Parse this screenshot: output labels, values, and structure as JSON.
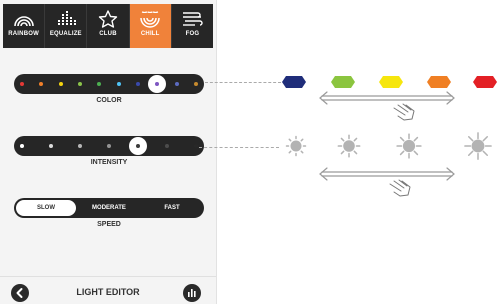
{
  "mode_bar": {
    "modes": [
      {
        "label": "RAINBOW",
        "icon": "rainbow-icon"
      },
      {
        "label": "EQUALIZE",
        "icon": "equalizer-icon"
      },
      {
        "label": "CLUB",
        "icon": "star-icon"
      },
      {
        "label": "CHILL",
        "icon": "waves-icon",
        "active": true
      },
      {
        "label": "FOG",
        "icon": "fog-icon"
      }
    ],
    "active_color": "#f0823a",
    "bar_color": "#262626"
  },
  "color_slider": {
    "caption": "COLOR",
    "dot_colors": [
      "#e53935",
      "#f07f2a",
      "#f4d20f",
      "#8bc34a",
      "#4caf50",
      "#4fc3f7",
      "#3949ab",
      "#7e57c2",
      "#5c6bc0",
      "#c68a2e"
    ],
    "selected_index": 7
  },
  "intensity_slider": {
    "caption": "INTENSITY",
    "positions": 7,
    "selected_index": 4
  },
  "speed_control": {
    "caption": "SPEED",
    "options": [
      "SLOW",
      "MODERATE",
      "FAST"
    ],
    "selected": "SLOW"
  },
  "footer": {
    "title": "LIGHT EDITOR",
    "back_icon": "chevron-left-icon",
    "right_icon": "bar-chart-icon"
  },
  "illustration": {
    "gem_colors": [
      "#1f2d7a",
      "#8bc53f",
      "#f6e60d",
      "#f07f23",
      "#e32025"
    ],
    "sun_count": 4
  }
}
